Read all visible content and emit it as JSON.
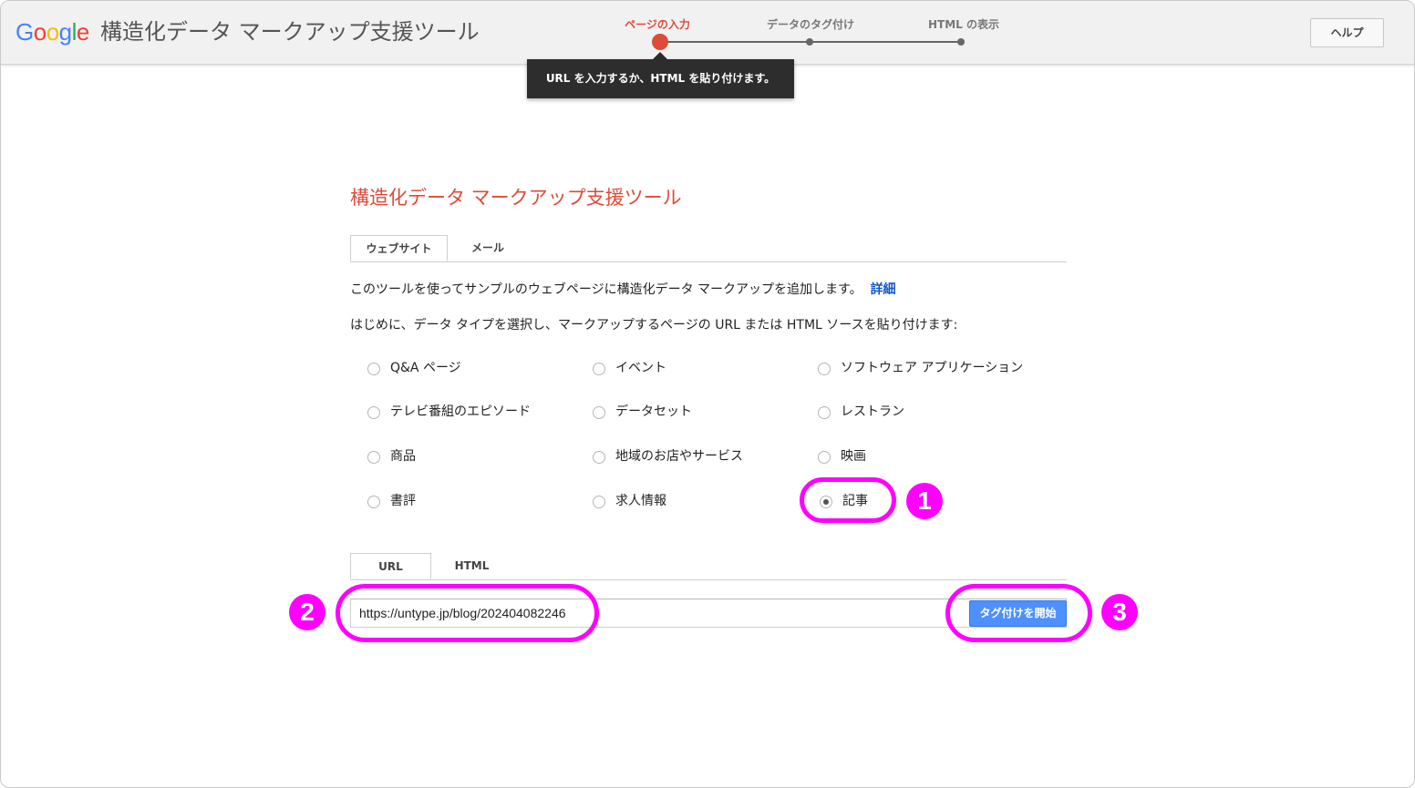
{
  "header": {
    "logo_letters": [
      {
        "char": "G",
        "color": "#4285f4"
      },
      {
        "char": "o",
        "color": "#ea4335"
      },
      {
        "char": "o",
        "color": "#fbbc05"
      },
      {
        "char": "g",
        "color": "#4285f4"
      },
      {
        "char": "l",
        "color": "#34a853"
      },
      {
        "char": "e",
        "color": "#ea4335"
      }
    ],
    "app_title": "構造化データ マークアップ支援ツール",
    "help_label": "ヘルプ"
  },
  "steps": [
    {
      "label": "ページの入力",
      "active": true
    },
    {
      "label": "データのタグ付け",
      "active": false
    },
    {
      "label": "HTML の表示",
      "active": false
    }
  ],
  "tooltip": "URL を入力するか、HTML を貼り付けます。",
  "main": {
    "title": "構造化データ マークアップ支援ツール",
    "tabs": [
      {
        "label": "ウェブサイト",
        "active": true
      },
      {
        "label": "メール",
        "active": false
      }
    ],
    "intro": "このツールを使ってサンプルのウェブページに構造化データ マークアップを追加します。",
    "intro_link": "詳細",
    "instruction": "はじめに、データ タイプを選択し、マークアップするページの URL または HTML ソースを貼り付けます:",
    "data_types": [
      {
        "label": "Q&A ページ",
        "checked": false
      },
      {
        "label": "イベント",
        "checked": false
      },
      {
        "label": "ソフトウェア アプリケーション",
        "checked": false
      },
      {
        "label": "テレビ番組のエピソード",
        "checked": false
      },
      {
        "label": "データセット",
        "checked": false
      },
      {
        "label": "レストラン",
        "checked": false
      },
      {
        "label": "商品",
        "checked": false
      },
      {
        "label": "地域のお店やサービス",
        "checked": false
      },
      {
        "label": "映画",
        "checked": false
      },
      {
        "label": "書評",
        "checked": false
      },
      {
        "label": "求人情報",
        "checked": false
      },
      {
        "label": "記事",
        "checked": true
      }
    ],
    "source_tabs": [
      {
        "label": "URL",
        "active": true
      },
      {
        "label": "HTML",
        "active": false
      }
    ],
    "url_value": "https://untype.jp/blog/202404082246",
    "start_button": "タグ付けを開始"
  },
  "annotations": [
    "1",
    "2",
    "3"
  ],
  "colors": {
    "accent_red": "#dd4b39",
    "button_blue": "#4d90fe",
    "link_blue": "#1155cc",
    "annotation_magenta": "#ff00ff"
  }
}
